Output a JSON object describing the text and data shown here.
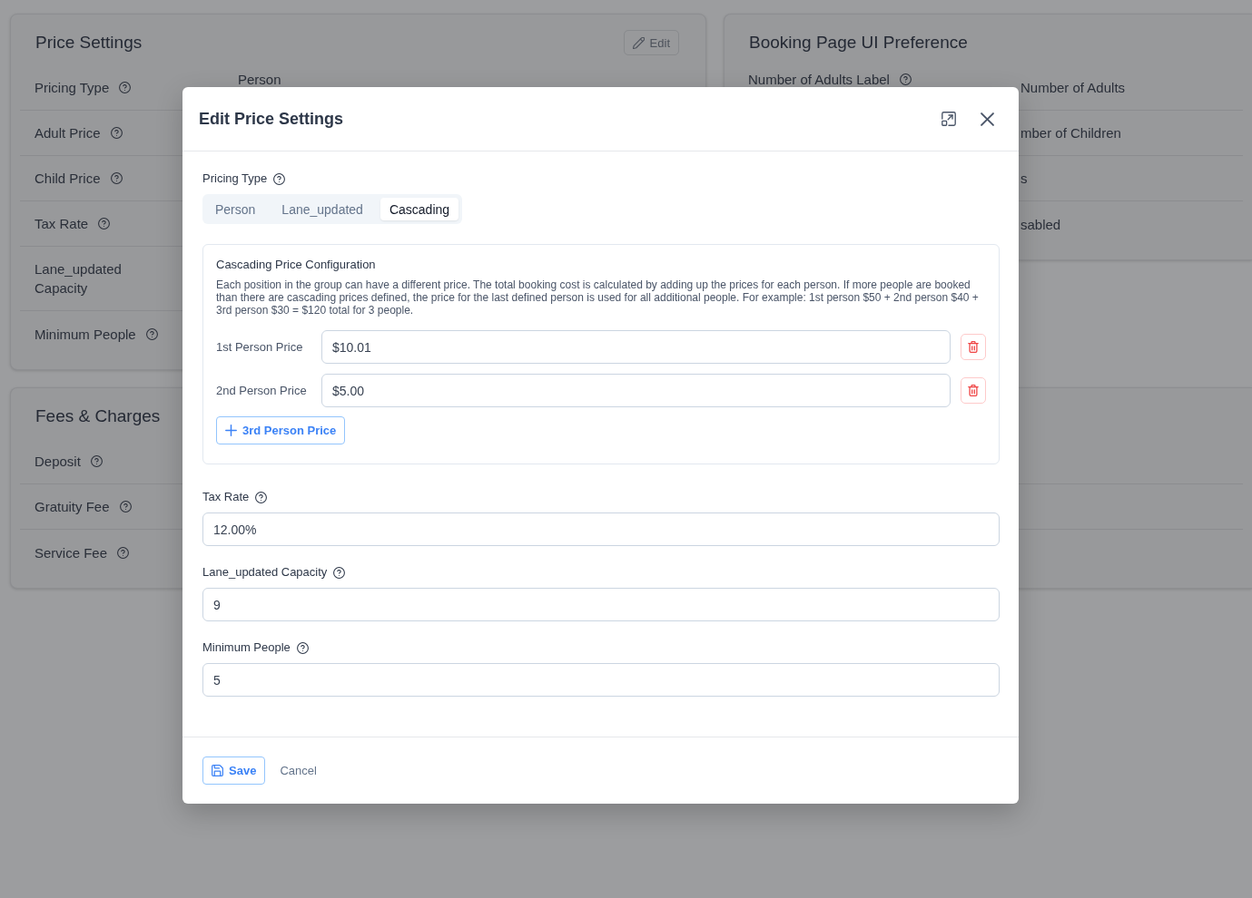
{
  "background": {
    "price_settings": {
      "title": "Price Settings",
      "edit_button": "Edit",
      "rows": [
        {
          "label": "Pricing Type",
          "help": true,
          "value": "Person"
        },
        {
          "label": "Adult Price",
          "help": true
        },
        {
          "label": "Child Price",
          "help": true
        },
        {
          "label": "Tax Rate",
          "help": true
        },
        {
          "label": "Lane_updated Capacity"
        },
        {
          "label": "Minimum People",
          "help": true
        }
      ]
    },
    "booking_page_ui": {
      "title": "Booking Page UI Preference",
      "rows": [
        {
          "label": "Number of Adults Label",
          "help": true,
          "value": "Number of Adults"
        },
        {
          "value": "mber of Children"
        },
        {
          "value": "s"
        },
        {
          "value": "sabled"
        }
      ]
    },
    "fees": {
      "title": "Fees & Charges",
      "rows": [
        {
          "label": "Deposit",
          "help": true
        },
        {
          "label": "Gratuity Fee",
          "help": true
        },
        {
          "label": "Service Fee",
          "help": true
        }
      ]
    }
  },
  "dialog": {
    "title": "Edit Price Settings",
    "pricing_type": {
      "label": "Pricing Type",
      "help": true,
      "options": [
        {
          "label": "Person",
          "selected": false
        },
        {
          "label": "Lane_updated",
          "selected": false
        },
        {
          "label": "Cascading",
          "selected": true
        }
      ]
    },
    "cascading": {
      "title": "Cascading Price Configuration",
      "description": "Each position in the group can have a different price. The total booking cost is calculated by adding up the prices for each person. If more people are booked than there are cascading prices defined, the price for the last defined person is used for all additional people. For example: 1st person $50 + 2nd person $40 + 3rd person $30 = $120 total for 3 people.",
      "tiers": [
        {
          "label": "1st Person Price",
          "value": "$10.01"
        },
        {
          "label": "2nd Person Price",
          "value": "$5.00"
        }
      ],
      "add_button": "3rd Person Price"
    },
    "fields": [
      {
        "label": "Tax Rate",
        "help": true,
        "value": "12.00%"
      },
      {
        "label": "Lane_updated Capacity",
        "help": true,
        "value": "9"
      },
      {
        "label": "Minimum People",
        "help": true,
        "value": "5"
      }
    ],
    "footer": {
      "save": "Save",
      "cancel": "Cancel"
    }
  }
}
